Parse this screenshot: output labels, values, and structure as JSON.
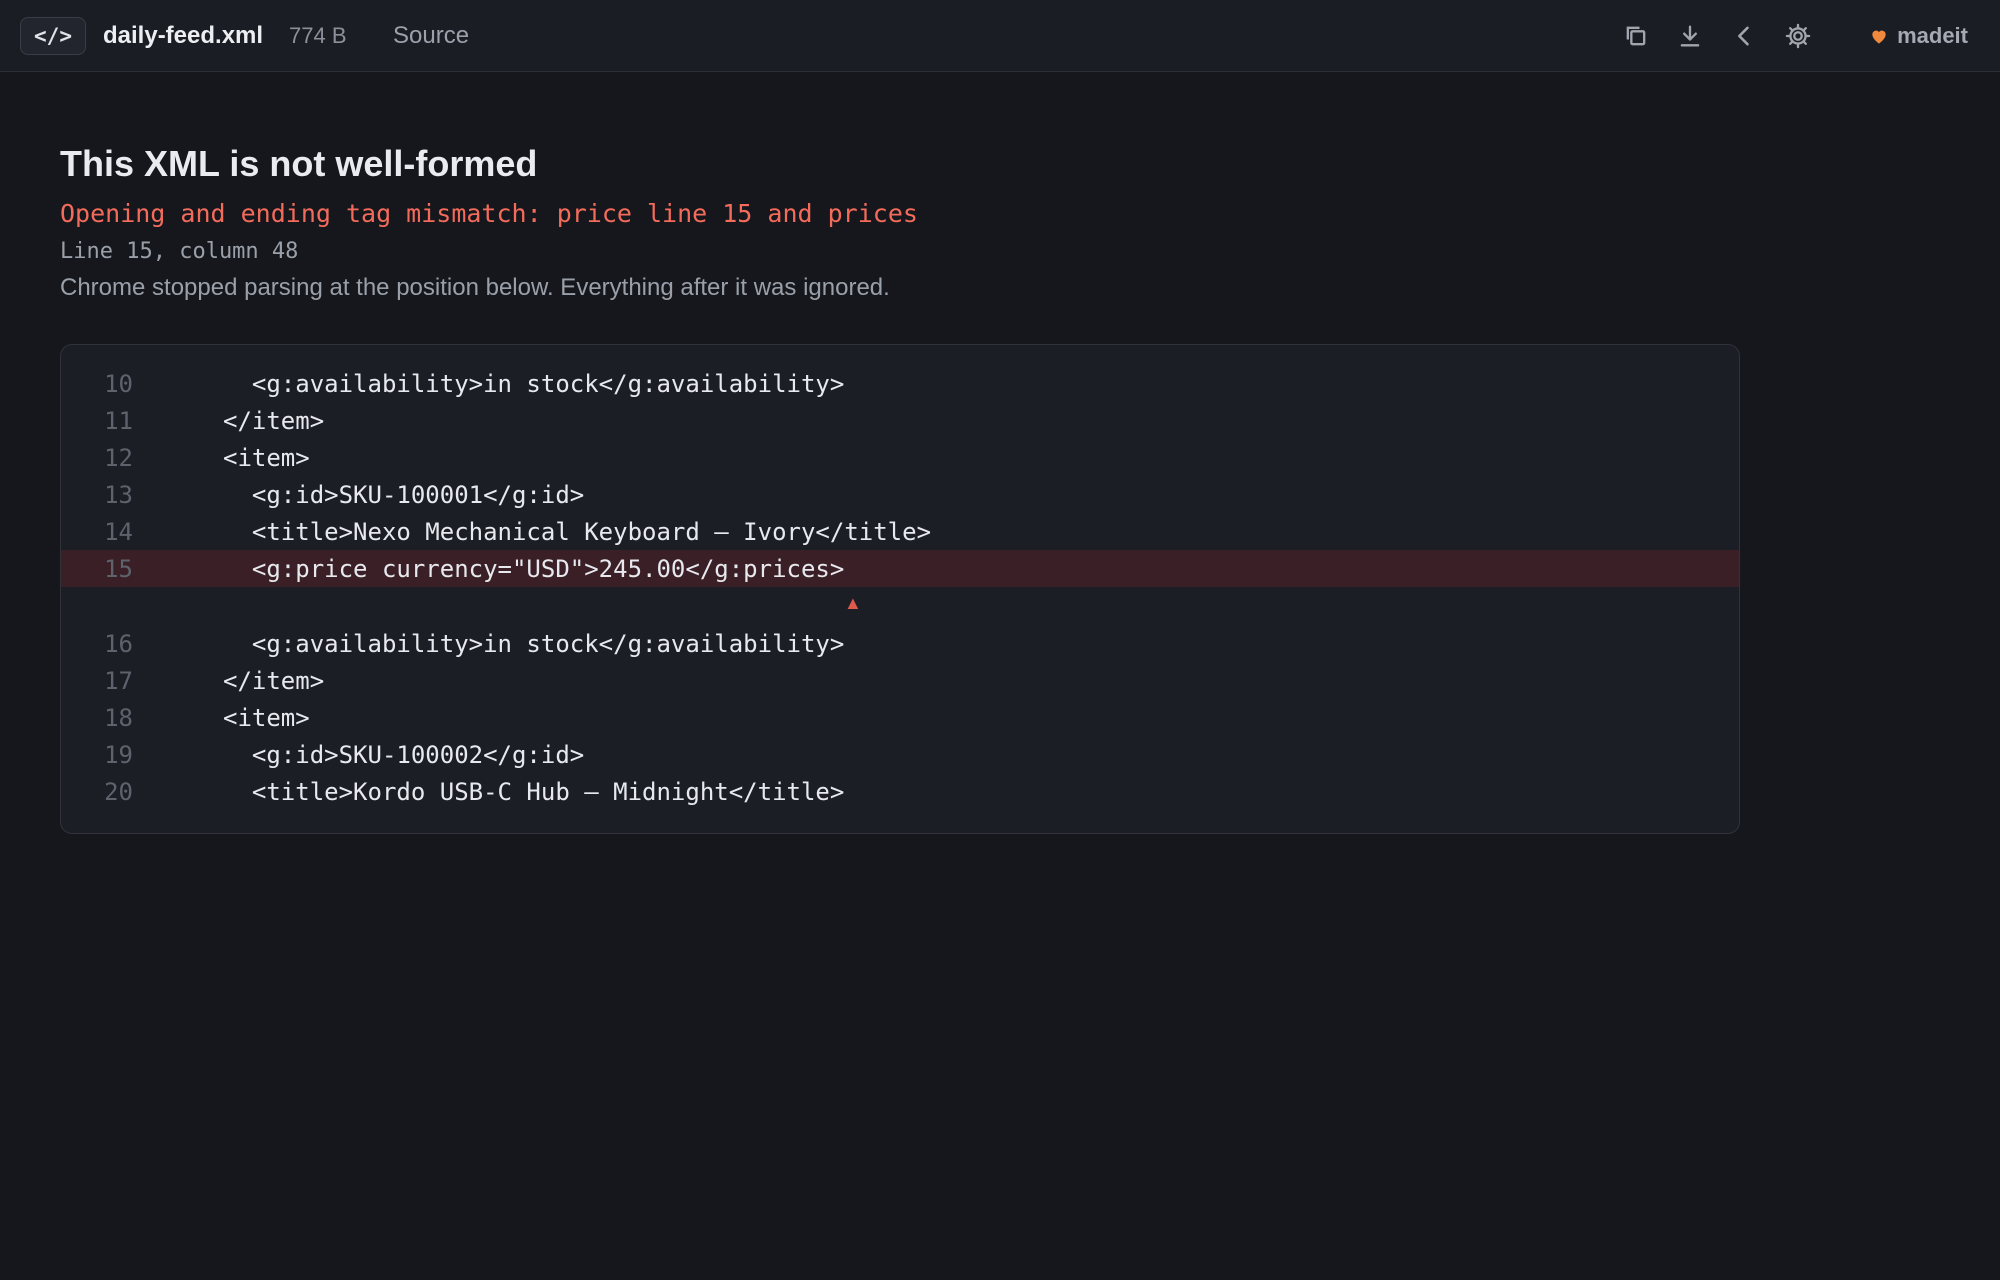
{
  "topbar": {
    "badge": "</>",
    "filename": "daily-feed.xml",
    "filesize": "774 B",
    "source_tab": "Source",
    "icons": [
      "copy-icon",
      "download-icon",
      "chevron-left-icon",
      "gear-icon"
    ],
    "user_name": "madeit",
    "heart_color": "#f0883e"
  },
  "error": {
    "heading": "This XML is not well-formed",
    "message": "Opening and ending tag mismatch: price line 15 and prices",
    "position": "Line 15, column 48",
    "note": "Chrome stopped parsing at the position below. Everything after it was ignored.",
    "error_color": "#f26b5b"
  },
  "code": {
    "lines": [
      {
        "num": "10",
        "text": "  <g:availability>in stock</g:availability>"
      },
      {
        "num": "11",
        "text": "</item>"
      },
      {
        "num": "12",
        "text": "<item>"
      },
      {
        "num": "13",
        "text": "  <g:id>SKU-100001</g:id>"
      },
      {
        "num": "14",
        "text": "  <title>Nexo Mechanical Keyboard — Ivory</title>"
      },
      {
        "num": "15",
        "text": "  <g:price currency=\"USD\">245.00</g:prices>"
      },
      {
        "num": "16",
        "text": "  <g:availability>in stock</g:availability>"
      },
      {
        "num": "17",
        "text": "</item>"
      },
      {
        "num": "18",
        "text": "<item>"
      },
      {
        "num": "19",
        "text": "  <g:id>SKU-100002</g:id>"
      },
      {
        "num": "20",
        "text": "  <title>Kordo USB-C Hub — Midnight</title>"
      }
    ],
    "caret": "▲"
  }
}
